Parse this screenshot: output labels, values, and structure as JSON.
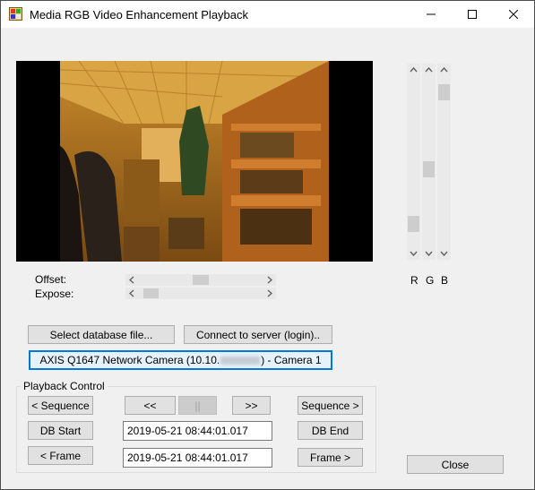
{
  "window": {
    "title": "Media RGB Video Enhancement Playback"
  },
  "sliders": {
    "offset_label": "Offset:",
    "expose_label": "Expose:",
    "offset_level": 0.5,
    "expose_level": 0.05
  },
  "channels": {
    "r_label": "R",
    "g_label": "G",
    "b_label": "B",
    "r_level": 0.9,
    "g_level": 0.55,
    "b_level": 0.05
  },
  "buttons": {
    "select_db": "Select database file...",
    "connect": "Connect to server (login)..",
    "camera_prefix": "AXIS Q1647 Network Camera (10.10.",
    "camera_suffix": ") - Camera 1",
    "close": "Close"
  },
  "playback": {
    "group_title": "Playback Control",
    "prev_sequence": "< Sequence",
    "rewind": "<<",
    "pause": "||",
    "forward": ">>",
    "next_sequence": "Sequence >",
    "db_start": "DB Start",
    "db_end": "DB End",
    "prev_frame": "< Frame",
    "next_frame": "Frame >",
    "timestamp_1": "2019-05-21 08:44:01.017",
    "timestamp_2": "2019-05-21 08:44:01.017"
  }
}
